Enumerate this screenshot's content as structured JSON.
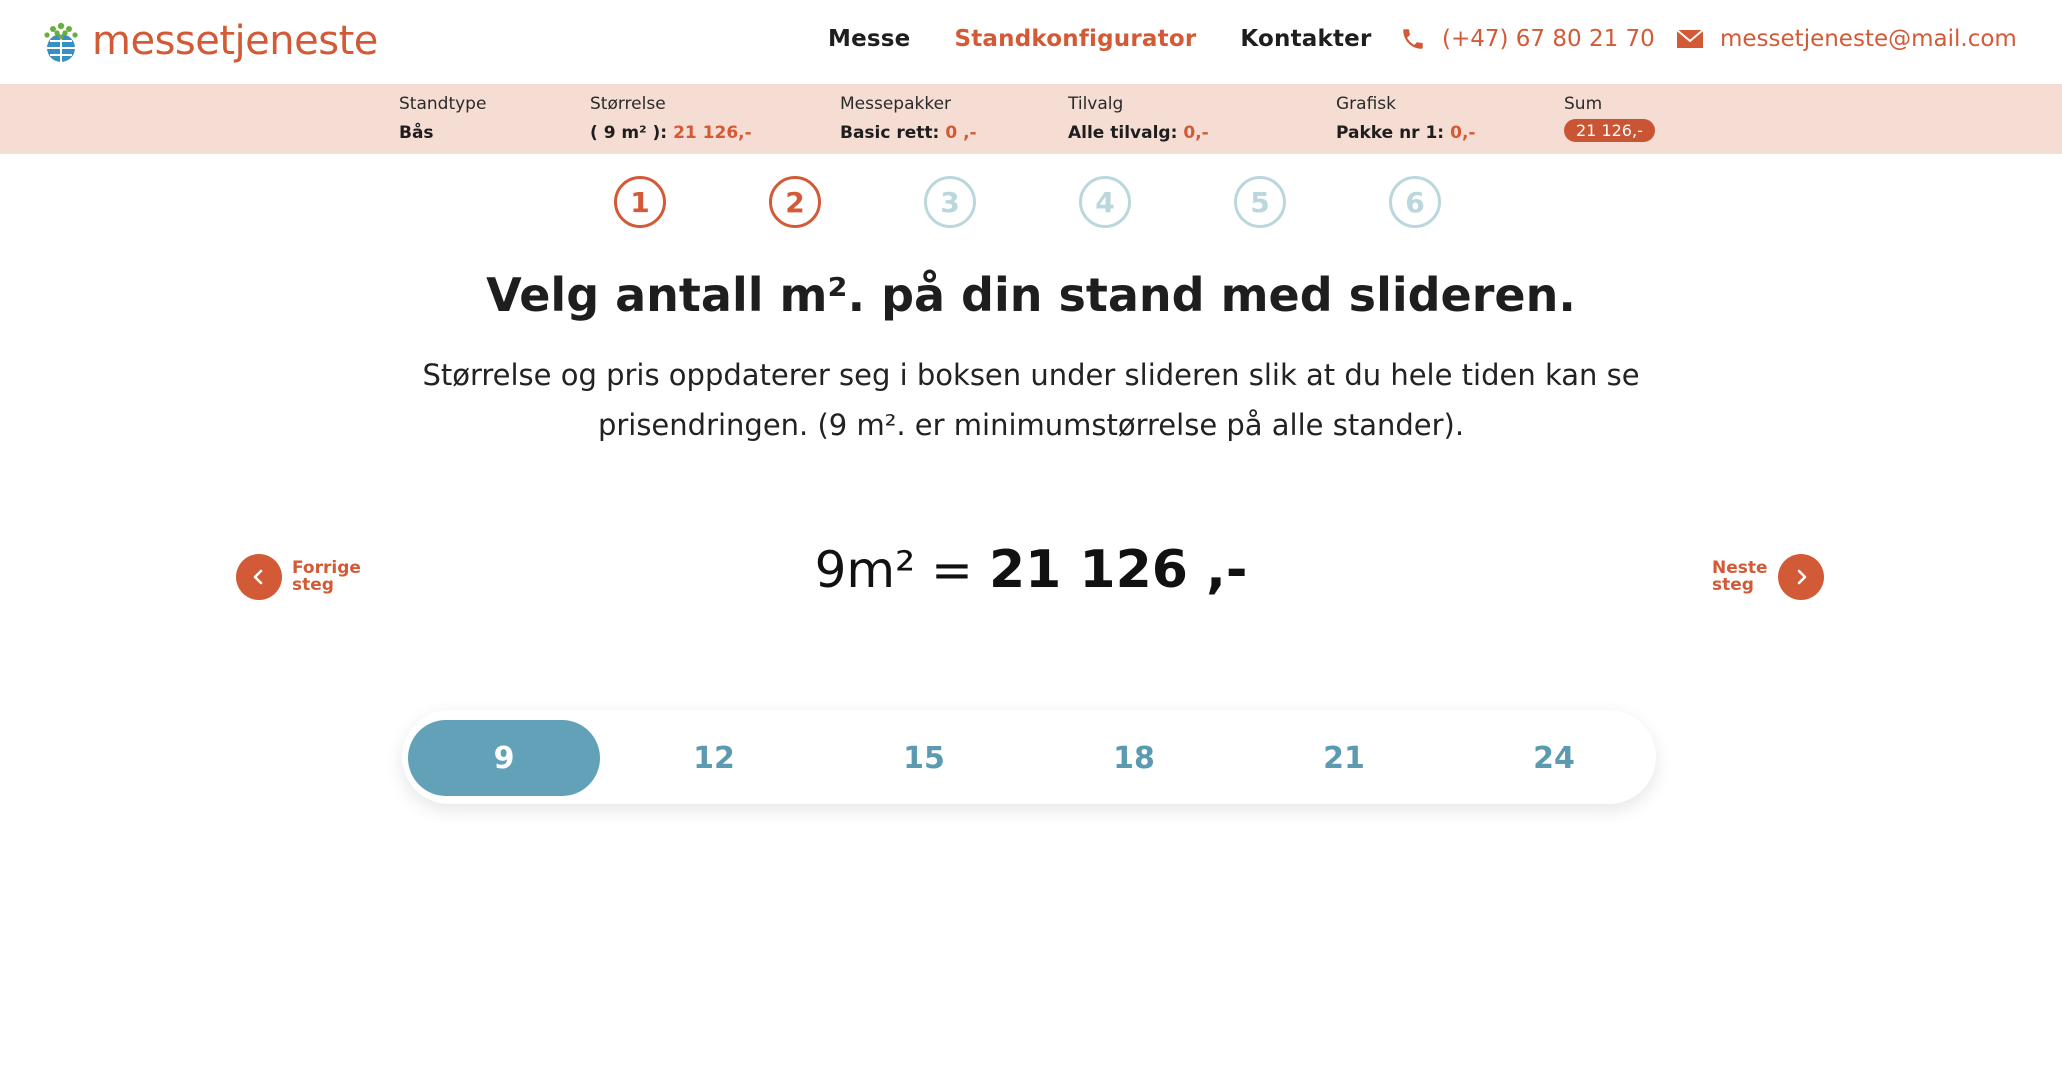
{
  "brand": {
    "name": "messetjeneste"
  },
  "nav": {
    "items": [
      "Messe",
      "Standkonfigurator",
      "Kontakter"
    ],
    "active_index": 1
  },
  "contact": {
    "phone": "(+47) 67 80 21 70",
    "email": "messetjeneste@mail.com"
  },
  "summary": {
    "standtype": {
      "title": "Standtype",
      "value": "Bås"
    },
    "storrelse": {
      "title": "Størrelse",
      "value": "( 9 m² ):",
      "price": "21 126,-"
    },
    "messepakker": {
      "title": "Messepakker",
      "value": "Basic rett:",
      "price": "0 ,-"
    },
    "tilvalg": {
      "title": "Tilvalg",
      "value": "Alle tilvalg:",
      "price": "0,-"
    },
    "grafisk": {
      "title": "Grafisk",
      "value": "Pakke nr 1:",
      "price": "0,-"
    },
    "sum": {
      "title": "Sum",
      "value": "21 126,-"
    }
  },
  "steps": [
    "1",
    "2",
    "3",
    "4",
    "5",
    "6"
  ],
  "steps_completed": 2,
  "heading": "Velg antall m². på din stand med slideren.",
  "description": "Størrelse og pris oppdaterer seg i boksen under slideren slik at du hele tiden kan se prisendringen. (9 m². er minimumstørrelse på alle stander).",
  "price_display": {
    "size": "9m² =",
    "price": "21 126 ,-"
  },
  "prev_button": {
    "line1": "Forrige",
    "line2": "steg"
  },
  "next_button": {
    "line1": "Neste",
    "line2": "steg"
  },
  "slider": {
    "options": [
      "9",
      "12",
      "15",
      "18",
      "21",
      "24"
    ],
    "selected": "9"
  },
  "colors": {
    "accent": "#d35a36",
    "slider": "#62a1b7",
    "summary_bg": "#f6ddd4",
    "inactive_step": "#b9d7dc"
  }
}
